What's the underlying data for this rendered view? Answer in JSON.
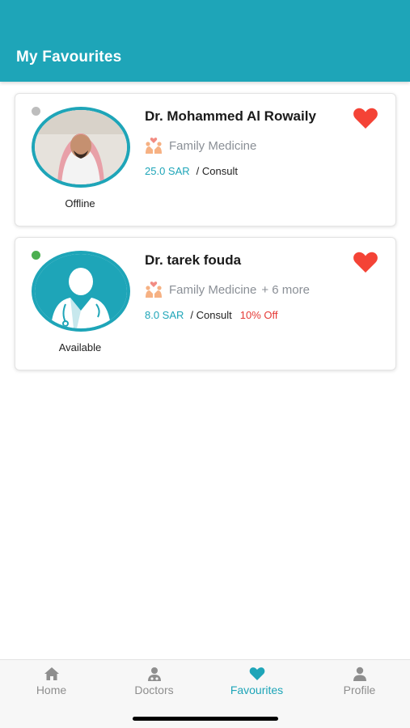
{
  "header": {
    "title": "My Favourites"
  },
  "doctors": [
    {
      "name": "Dr. Mohammed Al Rowaily",
      "specialty": "Family Medicine",
      "more": "",
      "price": "25.0 SAR",
      "per": "/ Consult",
      "discount": "",
      "status": "Offline",
      "favourited": true
    },
    {
      "name": "Dr. tarek fouda",
      "specialty": "Family Medicine",
      "more": "+ 6 more",
      "price": "8.0 SAR",
      "per": "/ Consult",
      "discount": "10% Off",
      "status": "Available",
      "favourited": true
    }
  ],
  "tabs": [
    {
      "label": "Home",
      "icon": "home-icon"
    },
    {
      "label": "Doctors",
      "icon": "doctor-icon"
    },
    {
      "label": "Favourites",
      "icon": "heart-icon",
      "active": true
    },
    {
      "label": "Profile",
      "icon": "person-icon"
    }
  ],
  "colors": {
    "accent": "#1ea5b8",
    "heart": "#f44336",
    "discount": "#e53935",
    "online": "#4caf50",
    "offline": "#bdbdbd"
  }
}
